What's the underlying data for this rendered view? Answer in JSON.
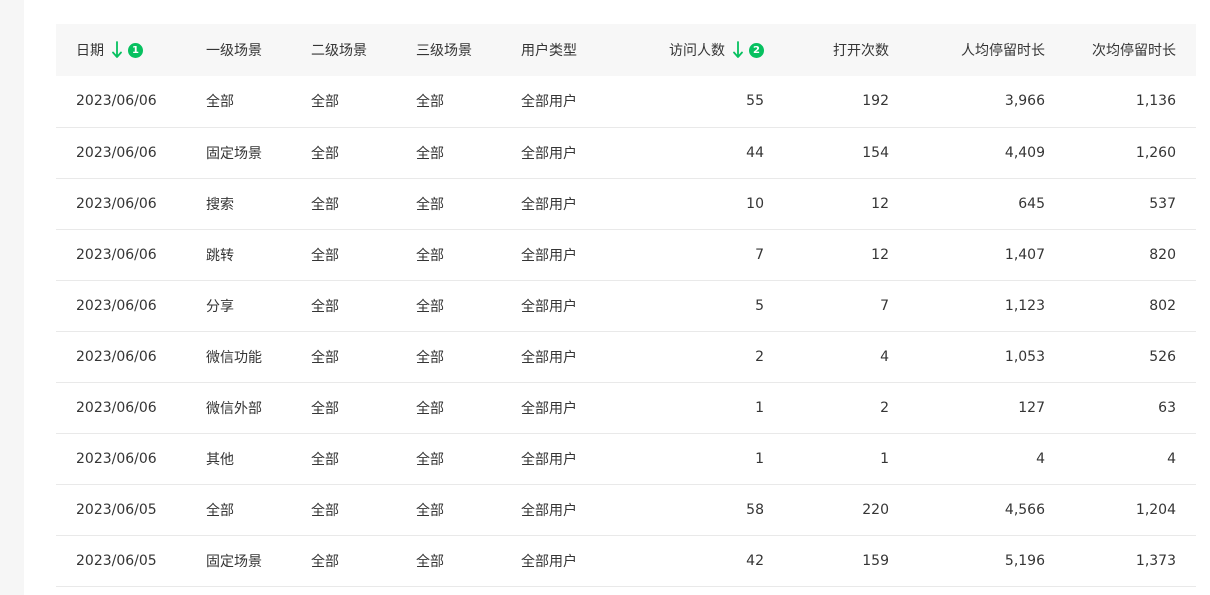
{
  "colors": {
    "accent": "#07c160",
    "header_bg": "#f7f7f7",
    "row_border": "#e9e9e9",
    "side_strip": "#f6f6f6"
  },
  "table": {
    "columns": [
      {
        "label": "日期",
        "sort_order": "1",
        "sort_icon": "arrow-down-icon"
      },
      {
        "label": "一级场景"
      },
      {
        "label": "二级场景"
      },
      {
        "label": "三级场景"
      },
      {
        "label": "用户类型"
      },
      {
        "label": "访问人数",
        "sort_order": "2",
        "sort_icon": "arrow-down-icon"
      },
      {
        "label": "打开次数"
      },
      {
        "label": "人均停留时长"
      },
      {
        "label": "次均停留时长"
      }
    ],
    "rows": [
      [
        "2023/06/06",
        "全部",
        "全部",
        "全部",
        "全部用户",
        "55",
        "192",
        "3,966",
        "1,136"
      ],
      [
        "2023/06/06",
        "固定场景",
        "全部",
        "全部",
        "全部用户",
        "44",
        "154",
        "4,409",
        "1,260"
      ],
      [
        "2023/06/06",
        "搜索",
        "全部",
        "全部",
        "全部用户",
        "10",
        "12",
        "645",
        "537"
      ],
      [
        "2023/06/06",
        "跳转",
        "全部",
        "全部",
        "全部用户",
        "7",
        "12",
        "1,407",
        "820"
      ],
      [
        "2023/06/06",
        "分享",
        "全部",
        "全部",
        "全部用户",
        "5",
        "7",
        "1,123",
        "802"
      ],
      [
        "2023/06/06",
        "微信功能",
        "全部",
        "全部",
        "全部用户",
        "2",
        "4",
        "1,053",
        "526"
      ],
      [
        "2023/06/06",
        "微信外部",
        "全部",
        "全部",
        "全部用户",
        "1",
        "2",
        "127",
        "63"
      ],
      [
        "2023/06/06",
        "其他",
        "全部",
        "全部",
        "全部用户",
        "1",
        "1",
        "4",
        "4"
      ],
      [
        "2023/06/05",
        "全部",
        "全部",
        "全部",
        "全部用户",
        "58",
        "220",
        "4,566",
        "1,204"
      ],
      [
        "2023/06/05",
        "固定场景",
        "全部",
        "全部",
        "全部用户",
        "42",
        "159",
        "5,196",
        "1,373"
      ]
    ]
  }
}
